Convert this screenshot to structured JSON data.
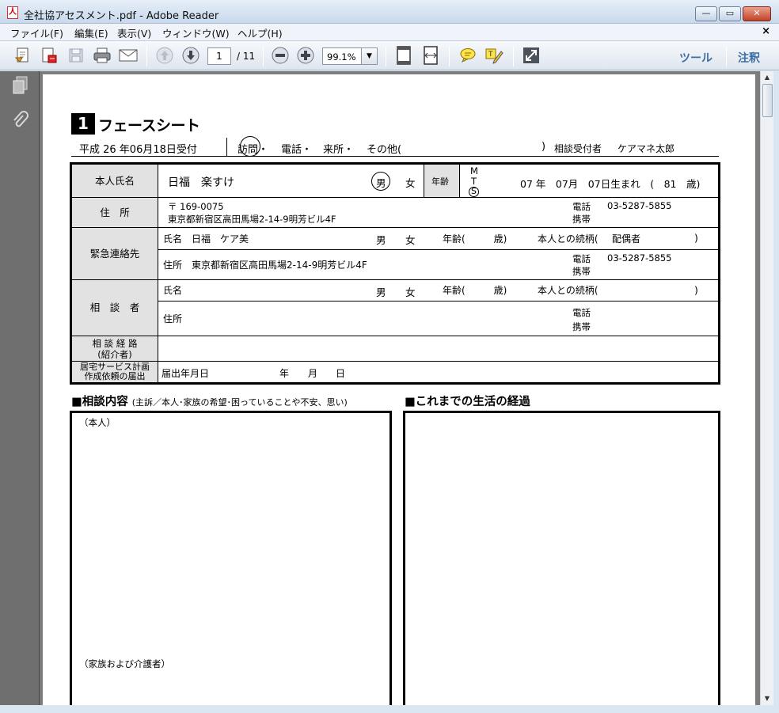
{
  "window": {
    "title": "全社協アセスメント.pdf - Adobe Reader",
    "app_icon": "pdf-icon",
    "controls": [
      "minimize",
      "maximize",
      "close"
    ]
  },
  "menu": {
    "items": [
      "ファイル(F)",
      "編集(E)",
      "表示(V)",
      "ウィンドウ(W)",
      "ヘルプ(H)"
    ],
    "close_glyph": "×"
  },
  "toolbar": {
    "page_current": "1",
    "page_total": "/ 11",
    "zoom": "99.1%",
    "tools_label": "ツール",
    "comment_label": "注釈"
  },
  "document": {
    "sheet_number": "1",
    "sheet_title": "フェースシート",
    "reception": {
      "date": "平成 26 年06月18日受付",
      "visit": "訪問・",
      "phone": "電話・",
      "office": "来所・",
      "other": "その他(",
      "other_close": ")",
      "receiver_label": "相談受付者",
      "receiver_name": "ケアマネ太郎"
    },
    "person": {
      "label": "本人氏名",
      "name": "日福　楽すけ",
      "male": "男",
      "female": "女",
      "age_label": "年齢",
      "era_m": "M",
      "era_t": "T",
      "era_s": "S",
      "birth": "07 年　07月　07日生まれ　(　81　歳)"
    },
    "address": {
      "label": "住　所",
      "postal": "〒 169-0075",
      "line": "東京都新宿区高田馬場2-14-9明芳ビル4F",
      "tel_label": "電話",
      "tel": "03-5287-5855",
      "mobile_label": "携帯"
    },
    "emergency": {
      "label": "緊急連絡先",
      "name_row": "氏名　日福　ケア美",
      "male": "男",
      "female": "女",
      "age": "年齢(　　　歳)",
      "relation": "本人との続柄(",
      "relation_value": "配偶者",
      "relation_close": ")",
      "addr_row": "住所　東京都新宿区高田馬場2-14-9明芳ビル4F",
      "tel_label": "電話",
      "tel": "03-5287-5855",
      "mobile_label": "携帯"
    },
    "consultant": {
      "label": "相　談　者",
      "name_row": "氏名",
      "male": "男",
      "female": "女",
      "age": "年齢(　　　歳)",
      "relation": "本人との続柄(",
      "relation_close": ")",
      "addr_row": "住所",
      "tel_label": "電話",
      "mobile_label": "携帯"
    },
    "route": {
      "label_1": "相 談 経 路",
      "label_2": "(紹介者)"
    },
    "plan": {
      "label_1": "居宅サービス計画",
      "label_2": "作成依頼の届出",
      "notice": "届出年月日",
      "year": "年",
      "month": "月",
      "day": "日"
    },
    "consult_section": {
      "title": "■相談内容",
      "subtitle": "(主訴／本人･家族の希望･困っていることや不安、思い)",
      "self": "（本人）",
      "family": "（家族および介護者）"
    },
    "history_section": {
      "title": "■これまでの生活の経過"
    }
  }
}
